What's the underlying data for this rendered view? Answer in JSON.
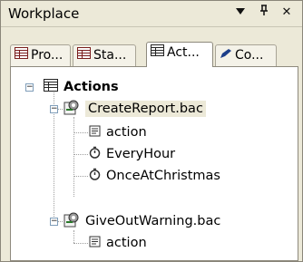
{
  "window": {
    "title": "Workplace",
    "dropdown_icon": "triangle-down-icon",
    "pin_icon": "pin-icon",
    "close_label": "✕"
  },
  "tabs": [
    {
      "label": "Pro...",
      "icon": "table-icon",
      "active": false
    },
    {
      "label": "Sta...",
      "icon": "table-icon",
      "active": false
    },
    {
      "label": "Act...",
      "icon": "table-icon",
      "active": true
    },
    {
      "label": "Co...",
      "icon": "pencil-icon",
      "active": false
    }
  ],
  "tree": {
    "root": {
      "label": "Actions",
      "icon": "table-icon",
      "expanded": true
    },
    "files": [
      {
        "label": "CreateReport.bac",
        "icon": "script-file-icon",
        "selected": true,
        "expanded": true,
        "children": [
          {
            "label": "action",
            "icon": "action-icon"
          },
          {
            "label": "EveryHour",
            "icon": "timer-icon"
          },
          {
            "label": "OnceAtChristmas",
            "icon": "timer-icon"
          }
        ]
      },
      {
        "label": "GiveOutWarning.bac",
        "icon": "script-file-icon",
        "selected": false,
        "expanded": true,
        "children": [
          {
            "label": "action",
            "icon": "action-icon"
          }
        ]
      }
    ]
  }
}
